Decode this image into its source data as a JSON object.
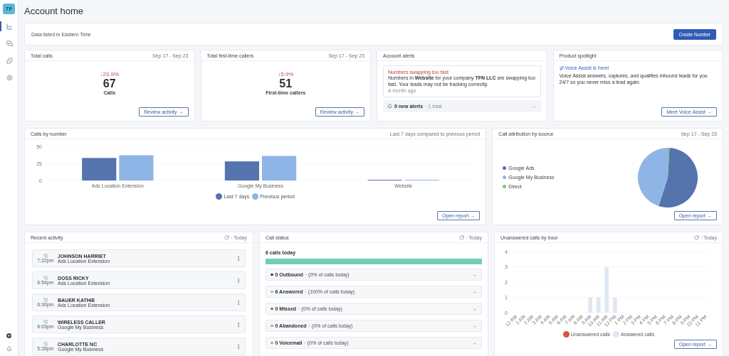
{
  "sidebar": {
    "avatar": "TF",
    "items": [
      {
        "kind": "chart",
        "selected": true
      },
      {
        "kind": "messages",
        "selected": false
      },
      {
        "kind": "puzzle",
        "selected": false
      },
      {
        "kind": "settings",
        "selected": false
      }
    ]
  },
  "page": {
    "title": "Account home"
  },
  "info_bar": {
    "text": "Data listed in Eastern Time",
    "button": "Create Number"
  },
  "stat_cards": [
    {
      "title": "Total calls",
      "range": "Sep 17 - Sep 23",
      "change": "↓23.9%",
      "value": "67",
      "label": "Calls",
      "button": "Review activity →"
    },
    {
      "title": "Total first-time callers",
      "range": "Sep 17 - Sep 23",
      "change": "↓5.9%",
      "value": "51",
      "label": "First-time callers",
      "button": "Review activity →"
    }
  ],
  "account_alerts": {
    "title": "Account alerts",
    "alert_title": "Numbers swapping too fast",
    "alert_text": "Numbers in **Website** for your company **TFN LLC** are swapping too fast. Your leads may not be tracking correctly.",
    "time": "A month ago",
    "footer": "0 new alerts",
    "footer_total": "· 1 total",
    "footer_arrow": "→"
  },
  "product_spotlight": {
    "title": "Product spotlight",
    "link": "Voice Assist is here!",
    "text": "Voice Assist answers, captures, and qualifies inbound leads for you 24/7 so you never miss a lead again.",
    "button": "Meet Voice Assist →"
  },
  "calls_by_number": {
    "title": "Calls by number",
    "range": "Last 7 days compared to previous period",
    "button": "Open report →",
    "chart_data": {
      "type": "bar",
      "categories": [
        "Ads Location Extension",
        "Google My Business",
        "Website"
      ],
      "ylim": [
        0,
        50
      ],
      "yticks": [
        0,
        25,
        50
      ],
      "series": [
        {
          "name": "Last 7 days",
          "color": "#5573ad",
          "values": [
            33,
            28,
            1
          ]
        },
        {
          "name": "Previous period",
          "color": "#8fb5e6",
          "values": [
            37,
            36,
            1
          ]
        }
      ]
    }
  },
  "call_attribution": {
    "title": "Call attribution by source",
    "range": "Sep 17 - Sep 23",
    "button": "Open report →",
    "legend": [
      {
        "label": "Google Ads",
        "color": "#5573ad"
      },
      {
        "label": "Google My Business",
        "color": "#8fb5e6"
      },
      {
        "label": "Direct",
        "color": "#7cc08a"
      }
    ]
  },
  "recent_activity": {
    "title": "Recent activity",
    "period": "· Today",
    "items": [
      {
        "name": "JOHNSON HARRIET",
        "time": "7:22pm",
        "source": "Ads Location Extension"
      },
      {
        "name": "DOSS RICKY",
        "time": "6:54pm",
        "source": "Ads Location Extension"
      },
      {
        "name": "BAUER KATHIE",
        "time": "6:30pm",
        "source": "Ads Location Extension"
      },
      {
        "name": "WIRELESS CALLER",
        "time": "6:03pm",
        "source": "Google My Business"
      },
      {
        "name": "CHARLOTTE NC",
        "time": "5:28pm",
        "source": "Google My Business"
      }
    ]
  },
  "call_status": {
    "title": "Call status",
    "period": "· Today",
    "summary": "6 calls today",
    "progress": {
      "level": 1
    },
    "rows": [
      {
        "label": "0 Outbound",
        "detail": "· (0% of calls today)",
        "arrow": "→",
        "color": "#2d3f6b"
      },
      {
        "label": "6 Answered",
        "detail": "· (100% of calls today)",
        "arrow": "→",
        "color": "#6fcfb9"
      },
      {
        "label": "0 Missed",
        "detail": "· (0% of calls today)",
        "arrow": "→",
        "color": "#c8483a"
      },
      {
        "label": "0 Abandoned",
        "detail": "· (0% of calls today)",
        "arrow": "→",
        "color": "#a0a4ab"
      },
      {
        "label": "0 Voicemail",
        "detail": "· (0% of calls today)",
        "arrow": "→",
        "color": "#e39a5f"
      }
    ]
  },
  "unanswered_by_hour": {
    "title": "Unanswered calls by hour",
    "period": "· Today",
    "button": "Open report →",
    "chart_data": {
      "type": "bar",
      "stacked": true,
      "ylim": [
        0,
        4
      ],
      "yticks": [
        0,
        1,
        2,
        3,
        4
      ],
      "categories": [
        "12 AM",
        "1 AM",
        "2 AM",
        "3 AM",
        "4 AM",
        "5 AM",
        "6 AM",
        "7 AM",
        "8 AM",
        "9 AM",
        "10 AM",
        "11 AM",
        "12 PM",
        "1 PM",
        "2 PM",
        "3 PM",
        "4 PM",
        "5 PM",
        "6 PM",
        "7 PM",
        "8 PM",
        "9 PM",
        "10 PM",
        "11 PM"
      ],
      "series": [
        {
          "name": "Unanswered calls",
          "color": "#d9553f",
          "values": [
            0,
            0,
            0,
            0,
            0,
            0,
            0,
            0,
            0,
            0,
            0,
            0,
            0,
            0,
            0,
            0,
            0,
            0,
            0,
            0,
            0,
            0,
            0,
            0
          ]
        },
        {
          "name": "Answered calls",
          "color": "#dfe7f3",
          "values": [
            0,
            0,
            0,
            0,
            0,
            0,
            0,
            0,
            0,
            1,
            1,
            3,
            1,
            0,
            0,
            0,
            0,
            0,
            0,
            0,
            0,
            0,
            0,
            0
          ]
        }
      ]
    }
  }
}
